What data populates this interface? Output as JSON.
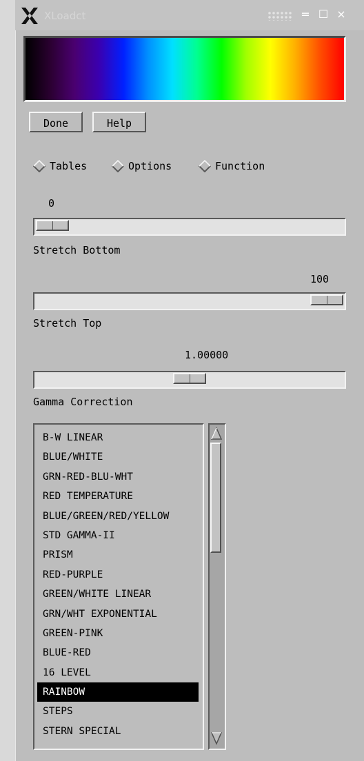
{
  "window": {
    "title": "XLoadct",
    "controls": {
      "minimize": "=",
      "maximize": "☐",
      "close": "×"
    }
  },
  "colorbar": {
    "stops": [
      "#000000",
      "#2a0030",
      "#4a0070",
      "#3a00b0",
      "#0020ff",
      "#0090ff",
      "#00e0ff",
      "#00ff90",
      "#00ff00",
      "#a0ff00",
      "#ffff00",
      "#ffb000",
      "#ff5000",
      "#ff0000"
    ]
  },
  "buttons": {
    "done": "Done",
    "help": "Help"
  },
  "modes": [
    {
      "label": "Tables",
      "selected": true
    },
    {
      "label": "Options",
      "selected": false
    },
    {
      "label": "Function",
      "selected": false
    }
  ],
  "sliders": {
    "stretch_bottom": {
      "value": "0",
      "label": "Stretch Bottom",
      "fraction": 0
    },
    "stretch_top": {
      "value": "100",
      "label": "Stretch Top",
      "fraction": 1
    },
    "gamma": {
      "value": "1.00000",
      "label": "Gamma Correction",
      "fraction": 0.5
    }
  },
  "color_tables": {
    "items": [
      "B-W LINEAR",
      "BLUE/WHITE",
      "GRN-RED-BLU-WHT",
      "RED TEMPERATURE",
      "BLUE/GREEN/RED/YELLOW",
      "STD GAMMA-II",
      "PRISM",
      "RED-PURPLE",
      "GREEN/WHITE LINEAR",
      "GRN/WHT EXPONENTIAL",
      "GREEN-PINK",
      "BLUE-RED",
      "16 LEVEL",
      "RAINBOW",
      "STEPS",
      "STERN SPECIAL"
    ],
    "selected": "RAINBOW"
  },
  "colors": {
    "accent_selected": "#000000",
    "window_bg": "#bdbdbd"
  }
}
